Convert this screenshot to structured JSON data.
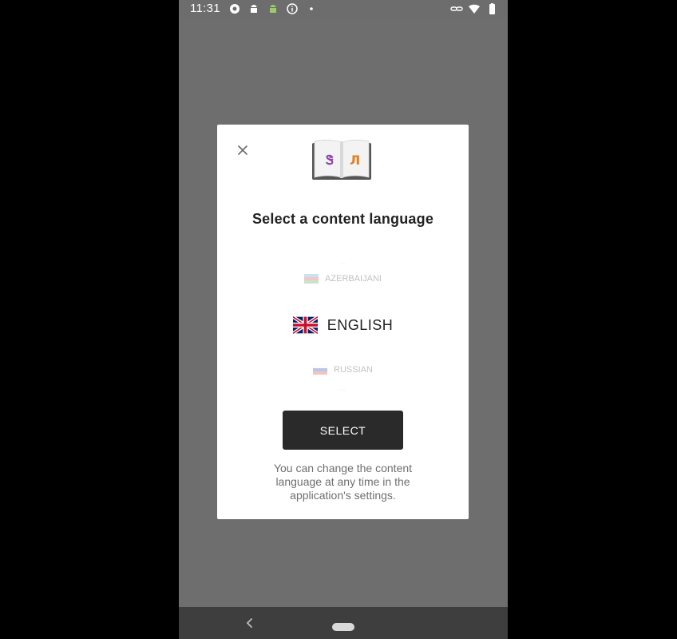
{
  "status_bar": {
    "time": "11:31"
  },
  "dialog": {
    "title": "Select a content language",
    "select_label": "SELECT",
    "hint": "You can change the content language at any time in the application's settings.",
    "languages": {
      "far_top": "...",
      "near_top": "AZERBAIJANI",
      "selected": "ENGLISH",
      "near_bottom": "RUSSIAN",
      "far_bottom": "..."
    }
  },
  "icons": {
    "close": "close-icon",
    "book": "book-icon",
    "nav_back": "back-icon",
    "nav_home": "home-pill"
  },
  "colors": {
    "button_bg": "#2a2a2a",
    "screen_dim": "#6d6d6d",
    "nav_bar": "#3e3e3e"
  }
}
